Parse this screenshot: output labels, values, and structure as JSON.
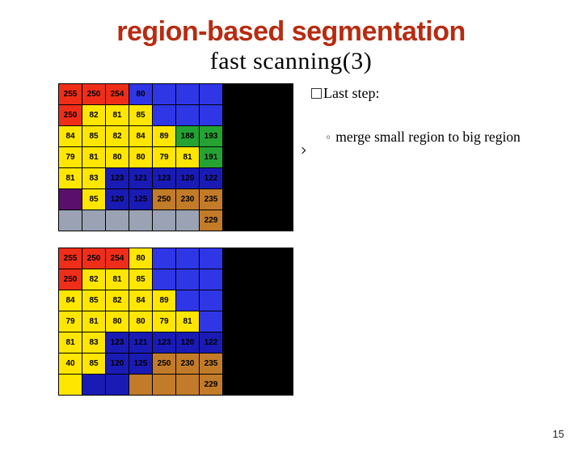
{
  "title": "region-based segmentation",
  "subtitle": "fast scanning(3)",
  "bullet_point": "Last step:",
  "sub_point": "merge small region to big region",
  "page_number": "15",
  "grids": {
    "rows": 7,
    "cols": 7,
    "top": [
      [
        {
          "v": "255",
          "c": "c-r"
        },
        {
          "v": "250",
          "c": "c-r"
        },
        {
          "v": "254",
          "c": "c-r"
        },
        {
          "v": "80",
          "c": "c-b"
        },
        {
          "v": "",
          "c": "c-b"
        },
        {
          "v": "",
          "c": "c-b"
        },
        {
          "v": "",
          "c": "c-b"
        }
      ],
      [
        {
          "v": "250",
          "c": "c-r"
        },
        {
          "v": "82",
          "c": "c-y"
        },
        {
          "v": "81",
          "c": "c-y"
        },
        {
          "v": "85",
          "c": "c-y"
        },
        {
          "v": "",
          "c": "c-b"
        },
        {
          "v": "",
          "c": "c-b"
        },
        {
          "v": "",
          "c": "c-b"
        }
      ],
      [
        {
          "v": "84",
          "c": "c-y"
        },
        {
          "v": "85",
          "c": "c-y"
        },
        {
          "v": "82",
          "c": "c-y"
        },
        {
          "v": "84",
          "c": "c-y"
        },
        {
          "v": "89",
          "c": "c-y"
        },
        {
          "v": "188",
          "c": "c-g"
        },
        {
          "v": "193",
          "c": "c-g"
        }
      ],
      [
        {
          "v": "79",
          "c": "c-y"
        },
        {
          "v": "81",
          "c": "c-y"
        },
        {
          "v": "80",
          "c": "c-y"
        },
        {
          "v": "80",
          "c": "c-y"
        },
        {
          "v": "79",
          "c": "c-y"
        },
        {
          "v": "81",
          "c": "c-y"
        },
        {
          "v": "191",
          "c": "c-g"
        }
      ],
      [
        {
          "v": "81",
          "c": "c-y"
        },
        {
          "v": "83",
          "c": "c-y"
        },
        {
          "v": "123",
          "c": "c-db"
        },
        {
          "v": "121",
          "c": "c-db"
        },
        {
          "v": "123",
          "c": "c-db"
        },
        {
          "v": "120",
          "c": "c-db"
        },
        {
          "v": "122",
          "c": "c-db"
        }
      ],
      [
        {
          "v": "",
          "c": "c-p"
        },
        {
          "v": "85",
          "c": "c-y"
        },
        {
          "v": "120",
          "c": "c-db"
        },
        {
          "v": "125",
          "c": "c-db"
        },
        {
          "v": "250",
          "c": "c-br"
        },
        {
          "v": "230",
          "c": "c-br"
        },
        {
          "v": "235",
          "c": "c-br"
        }
      ],
      [
        {
          "v": "",
          "c": "c-gr"
        },
        {
          "v": "",
          "c": "c-gr"
        },
        {
          "v": "",
          "c": "c-gr"
        },
        {
          "v": "",
          "c": "c-gr"
        },
        {
          "v": "",
          "c": "c-gr"
        },
        {
          "v": "",
          "c": "c-gr"
        },
        {
          "v": "229",
          "c": "c-br"
        }
      ]
    ],
    "bottom": [
      [
        {
          "v": "255",
          "c": "c-r"
        },
        {
          "v": "250",
          "c": "c-r"
        },
        {
          "v": "254",
          "c": "c-r"
        },
        {
          "v": "80",
          "c": "c-y"
        },
        {
          "v": "",
          "c": "c-b"
        },
        {
          "v": "",
          "c": "c-b"
        },
        {
          "v": "",
          "c": "c-b"
        }
      ],
      [
        {
          "v": "250",
          "c": "c-r"
        },
        {
          "v": "82",
          "c": "c-y"
        },
        {
          "v": "81",
          "c": "c-y"
        },
        {
          "v": "85",
          "c": "c-y"
        },
        {
          "v": "",
          "c": "c-b"
        },
        {
          "v": "",
          "c": "c-b"
        },
        {
          "v": "",
          "c": "c-b"
        }
      ],
      [
        {
          "v": "84",
          "c": "c-y"
        },
        {
          "v": "85",
          "c": "c-y"
        },
        {
          "v": "82",
          "c": "c-y"
        },
        {
          "v": "84",
          "c": "c-y"
        },
        {
          "v": "89",
          "c": "c-y"
        },
        {
          "v": "",
          "c": "c-b"
        },
        {
          "v": "",
          "c": "c-b"
        }
      ],
      [
        {
          "v": "79",
          "c": "c-y"
        },
        {
          "v": "81",
          "c": "c-y"
        },
        {
          "v": "80",
          "c": "c-y"
        },
        {
          "v": "80",
          "c": "c-y"
        },
        {
          "v": "79",
          "c": "c-y"
        },
        {
          "v": "81",
          "c": "c-y"
        },
        {
          "v": "",
          "c": "c-b"
        }
      ],
      [
        {
          "v": "81",
          "c": "c-y"
        },
        {
          "v": "83",
          "c": "c-y"
        },
        {
          "v": "123",
          "c": "c-db"
        },
        {
          "v": "121",
          "c": "c-db"
        },
        {
          "v": "123",
          "c": "c-db"
        },
        {
          "v": "120",
          "c": "c-db"
        },
        {
          "v": "122",
          "c": "c-db"
        }
      ],
      [
        {
          "v": "40",
          "c": "c-y"
        },
        {
          "v": "85",
          "c": "c-y"
        },
        {
          "v": "120",
          "c": "c-db"
        },
        {
          "v": "125",
          "c": "c-db"
        },
        {
          "v": "250",
          "c": "c-br"
        },
        {
          "v": "230",
          "c": "c-br"
        },
        {
          "v": "235",
          "c": "c-br"
        }
      ],
      [
        {
          "v": "",
          "c": "c-y"
        },
        {
          "v": "",
          "c": "c-db"
        },
        {
          "v": "",
          "c": "c-db"
        },
        {
          "v": "",
          "c": "c-br"
        },
        {
          "v": "",
          "c": "c-br"
        },
        {
          "v": "",
          "c": "c-br"
        },
        {
          "v": "229",
          "c": "c-br"
        }
      ]
    ]
  }
}
